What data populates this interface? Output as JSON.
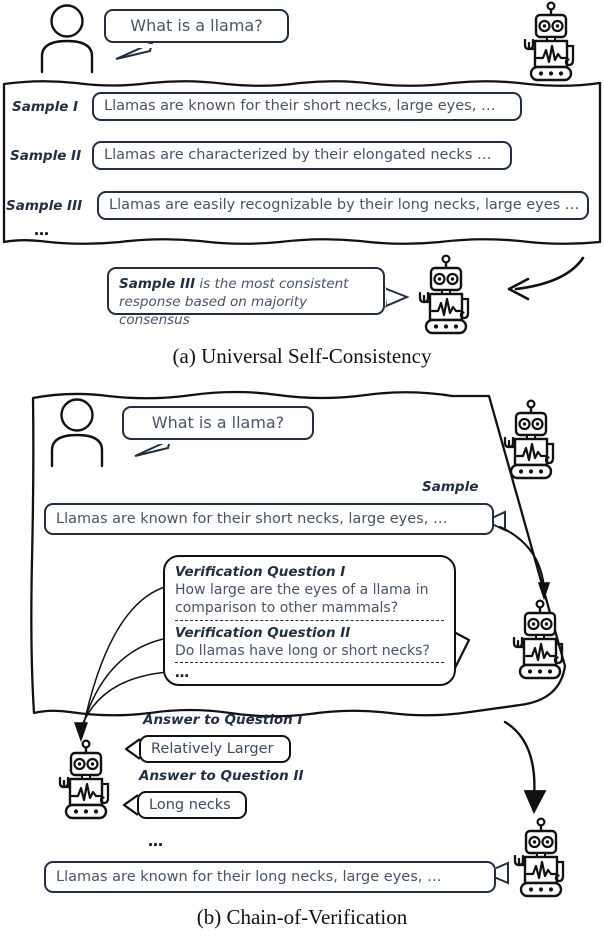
{
  "figures": [
    {
      "id": "universal-self-consistency",
      "caption": "(a) Universal Self-Consistency",
      "user_question": "What is a llama?",
      "samples": [
        {
          "label": "Sample I",
          "text": "Llamas are known for their short necks, large eyes, …"
        },
        {
          "label": "Sample II",
          "text": "Llamas are characterized by their elongated necks …"
        },
        {
          "label": "Sample III",
          "text": "Llamas are easily recognizable by their long necks, large eyes …"
        }
      ],
      "samples_ellipsis": "…",
      "verdict": {
        "emphasis": "Sample III",
        "rest": " is the most consistent response based on majority consensus"
      }
    },
    {
      "id": "chain-of-verification",
      "caption": "(b) Chain-of-Verification",
      "user_question": "What is a llama?",
      "sample_label": "Sample",
      "sample_text": "Llamas are known for their short necks, large eyes, …",
      "verification": {
        "items": [
          {
            "head": "Verification Question I",
            "body_line1": "How large are the eyes of a llama in",
            "body_line2": "comparison to other mammals?"
          },
          {
            "head": "Verification Question II",
            "body_line1": "Do llamas have long or short necks?",
            "body_line2": ""
          }
        ],
        "ellipsis": "…"
      },
      "answers": [
        {
          "label": "Answer to Question I",
          "text": "Relatively Larger"
        },
        {
          "label": "Answer to Question II",
          "text": "Long necks"
        }
      ],
      "answers_ellipsis": "…",
      "final_text": "Llamas are known for their long necks, large eyes, …"
    }
  ],
  "icons": {
    "user": "user-avatar-icon",
    "robot": "robot-icon",
    "arrow": "curved-arrow-icon"
  },
  "colors": {
    "navy": "#1f2d45",
    "text": "#46536b",
    "ink": "#111111"
  }
}
